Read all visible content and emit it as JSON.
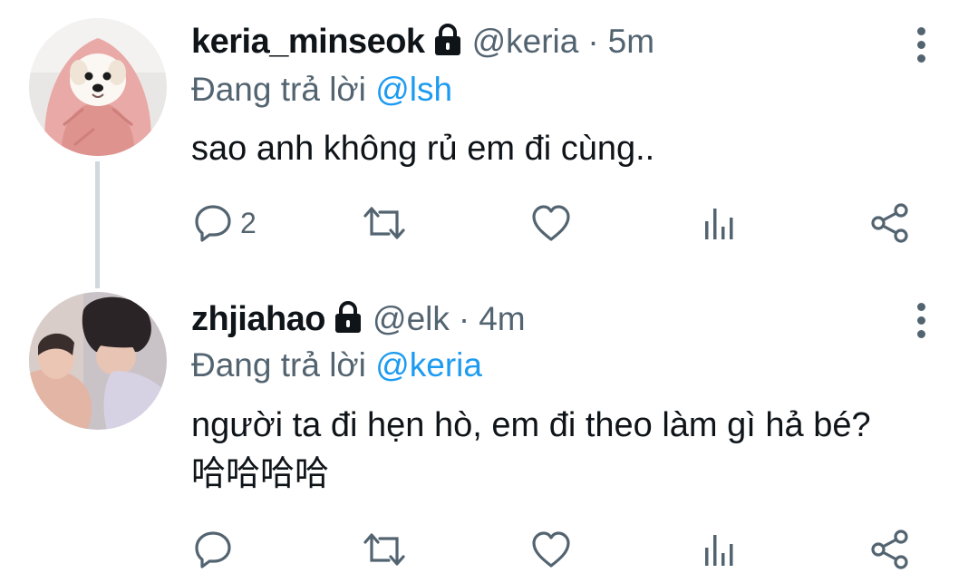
{
  "tweets": [
    {
      "display_name": "keria_minseok",
      "handle": "@keria",
      "separator": "·",
      "time": "5m",
      "replying_prefix": "Đang trả lời",
      "replying_to": "@lsh",
      "text_lines": [
        "sao anh không rủ em đi cùng.."
      ],
      "reply_count": "2",
      "avatar_icon": "puppy-in-pink-towel",
      "locked": true
    },
    {
      "display_name": "zhjiahao",
      "handle": "@elk",
      "separator": "·",
      "time": "4m",
      "replying_prefix": "Đang trả lời",
      "replying_to": "@keria",
      "text_lines": [
        "người ta đi hẹn hò, em đi theo làm gì hả bé?",
        "哈哈哈哈"
      ],
      "reply_count": "",
      "avatar_icon": "person-photo",
      "locked": true
    }
  ],
  "colors": {
    "text": "#0f1419",
    "secondary": "#536471",
    "accent": "#1d9bf0",
    "thread_line": "#cfd9de"
  }
}
